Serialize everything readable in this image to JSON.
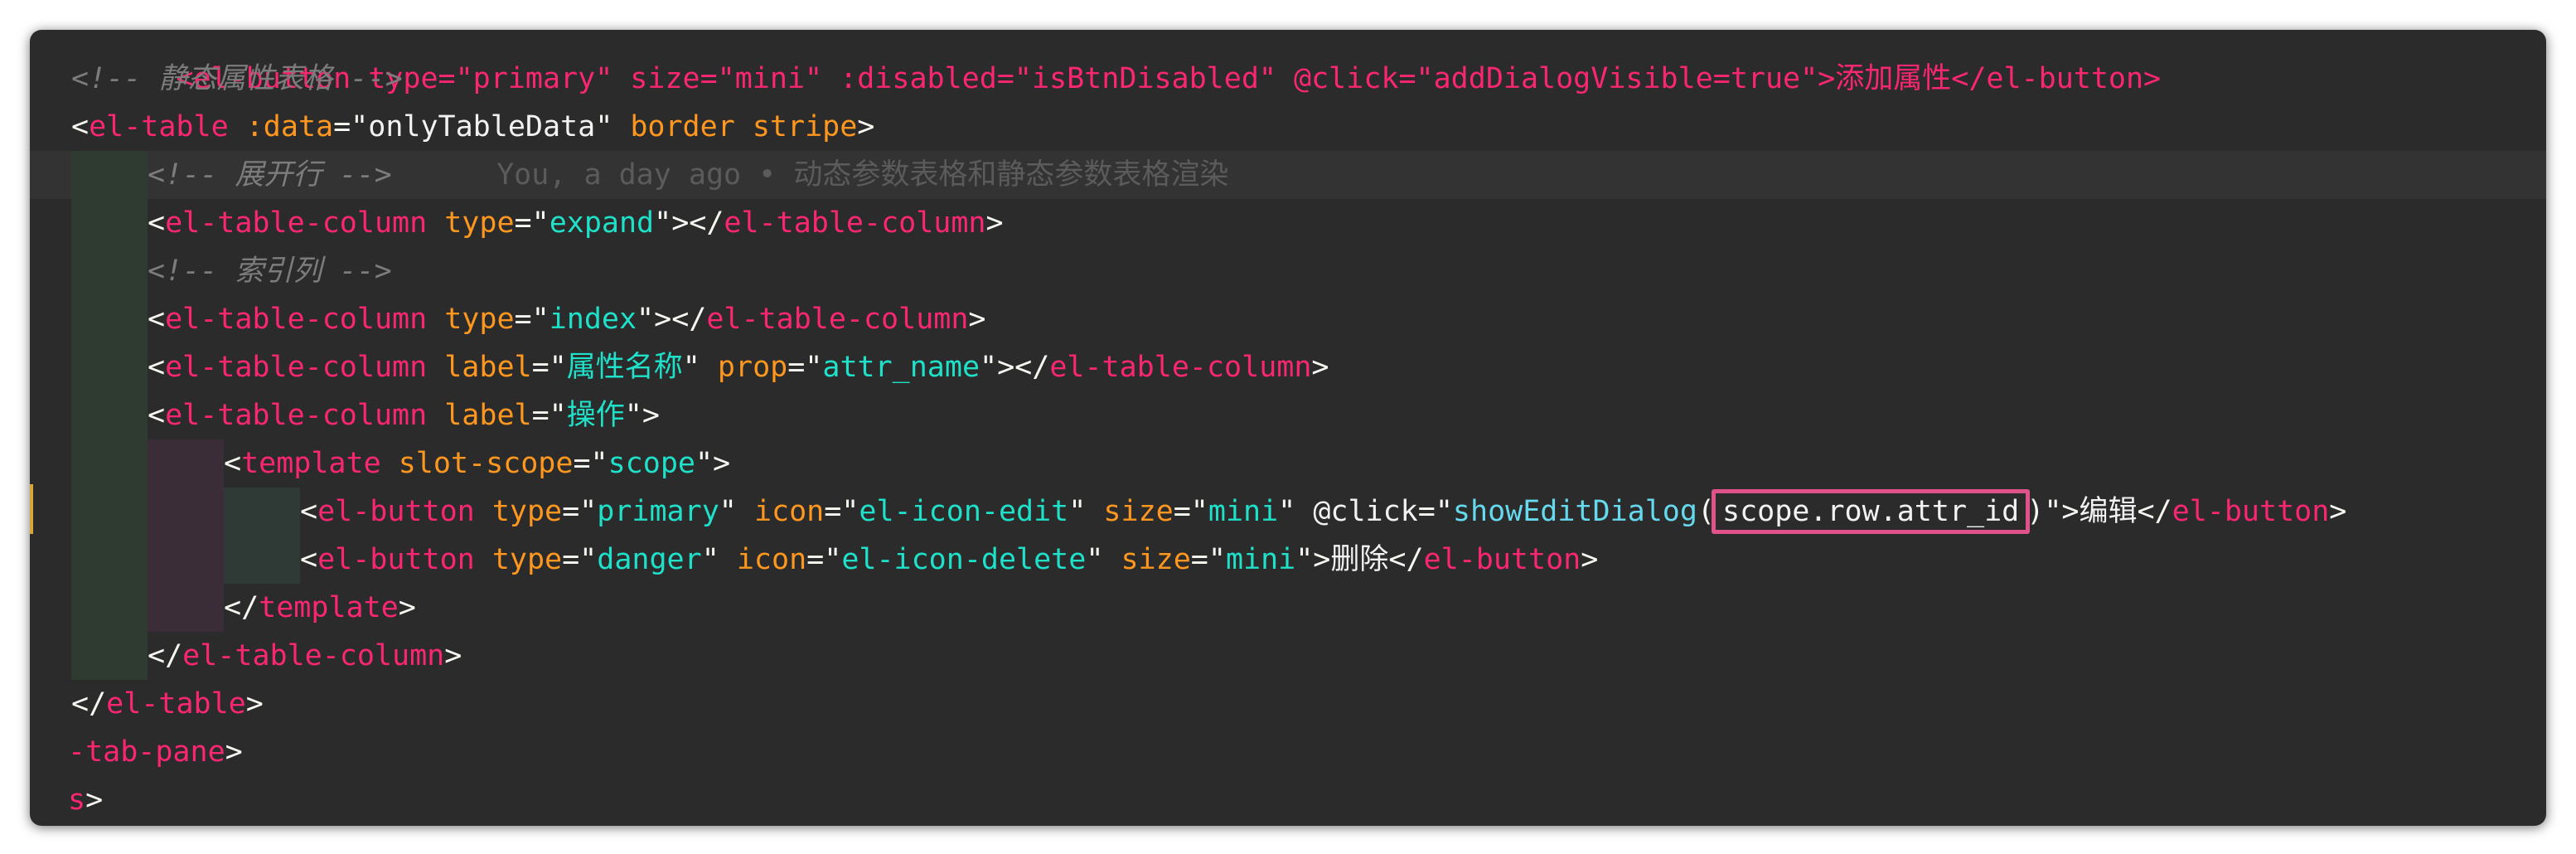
{
  "editor": {
    "lines": [
      {
        "kind": "partial-top",
        "text": "<el-button type=\"primary\" size=\"mini\" :disabled=\"isBtnDisabled\" @click=\"addDialogVisible=true\">添加属性</el-button>"
      },
      {
        "kind": "comment",
        "text": "<!-- 静态属性表格 -->"
      },
      {
        "kind": "tag-open",
        "tag": "el-table",
        "attr1": ":data",
        "val1": "onlyTableData",
        "attr2": "border",
        "attr3": "stripe"
      },
      {
        "kind": "comment-blame",
        "comment": "<!-- 展开行 -->",
        "blame": "You, a day ago • 动态参数表格和静态参数表格渲染"
      },
      {
        "kind": "column",
        "tag": "el-table-column",
        "attr": "type",
        "val": "expand",
        "close": "el-table-column"
      },
      {
        "kind": "comment",
        "text": "<!-- 索引列 -->"
      },
      {
        "kind": "column",
        "tag": "el-table-column",
        "attr": "type",
        "val": "index",
        "close": "el-table-column"
      },
      {
        "kind": "column2",
        "tag": "el-table-column",
        "attr": "label",
        "val": "属性名称",
        "attr2": "prop",
        "val2": "attr_name",
        "close": "el-table-column"
      },
      {
        "kind": "column-open",
        "tag": "el-table-column",
        "attr": "label",
        "val": "操作"
      },
      {
        "kind": "template-open",
        "tag": "template",
        "attr": "slot-scope",
        "val": "scope"
      },
      {
        "kind": "button-edit",
        "tag": "el-button",
        "type": "primary",
        "icon": "el-icon-edit",
        "size": "mini",
        "event": "@click",
        "fn": "showEditDialog",
        "arg": "scope.row.attr_id",
        "label": "编辑",
        "close": "el-button"
      },
      {
        "kind": "button-del",
        "tag": "el-button",
        "type": "danger",
        "icon": "el-icon-delete",
        "size": "mini",
        "label": "删除",
        "close": "el-button"
      },
      {
        "kind": "close",
        "tag": "template"
      },
      {
        "kind": "close",
        "tag": "el-table-column"
      },
      {
        "kind": "close",
        "tag": "el-table"
      },
      {
        "kind": "close-partial",
        "tag": "-tab-pane"
      },
      {
        "kind": "close-partial",
        "tag": "s"
      }
    ]
  },
  "colors": {
    "background": "#2b2b2b",
    "tag": "#f92672",
    "attribute": "#fd971f",
    "string": "#1fe0c8",
    "comment": "#7c7c7c",
    "function": "#66d9ef",
    "highlight_box": "#e0528a"
  }
}
